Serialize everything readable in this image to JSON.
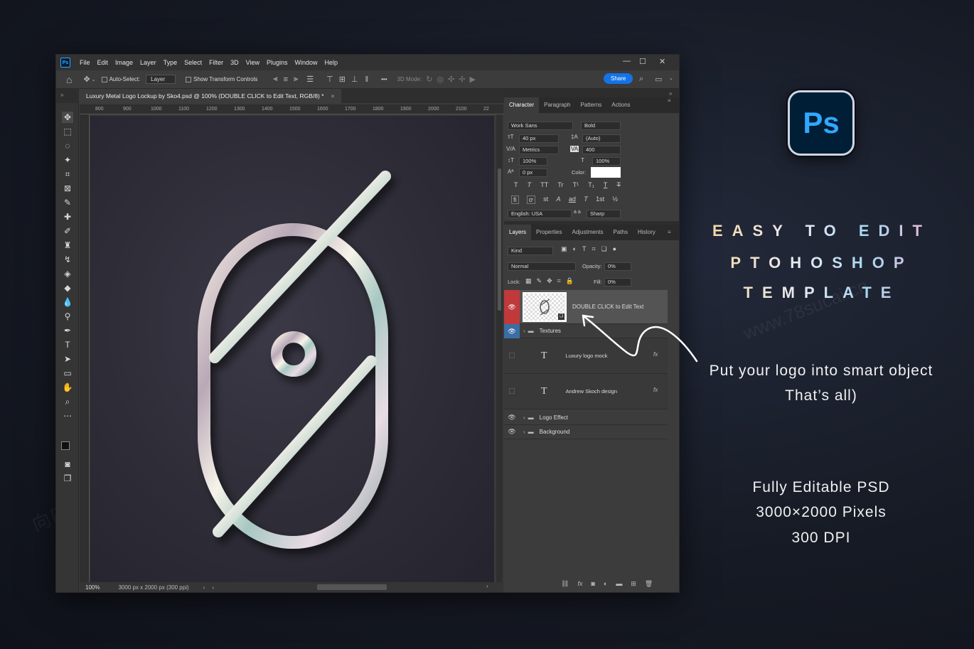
{
  "window": {
    "menu": [
      "File",
      "Edit",
      "Image",
      "Layer",
      "Type",
      "Select",
      "Filter",
      "3D",
      "View",
      "Plugins",
      "Window",
      "Help"
    ],
    "controls": [
      "—",
      "☐",
      "✕"
    ]
  },
  "options_bar": {
    "auto_select_label": "Auto-Select:",
    "auto_select_value": "Layer",
    "show_transform_label": "Show Transform Controls",
    "mode_3d_label": "3D Mode:",
    "more_label": "•••",
    "share_label": "Share"
  },
  "document": {
    "tab_title": "Luxury Metal Logo Lockup by Sko4.psd @ 100% (DOUBLE CLICK to Edit Text, RGB/8) *",
    "tab_close": "×",
    "ruler_top": [
      "800",
      "900",
      "1000",
      "1100",
      "1200",
      "1300",
      "1400",
      "1500",
      "1600",
      "1700",
      "1800",
      "1900",
      "2000",
      "2100",
      "22"
    ],
    "zoom": "100%",
    "size_info": "3000 px x 2000 px (300 ppi)"
  },
  "character_panel": {
    "tabs": [
      "Character",
      "Paragraph",
      "Patterns",
      "Actions"
    ],
    "font_family": "Work Sans",
    "font_style": "Bold",
    "size": "40 px",
    "leading": "(Auto)",
    "kerning": "Metrics",
    "tracking": "400",
    "vscale": "100%",
    "hscale": "100%",
    "baseline": "0 px",
    "color_label": "Color:",
    "language": "English: USA",
    "aa_label": "a a",
    "antialias": "Sharp",
    "type_buttons": [
      "T",
      "T",
      "TT",
      "Tr",
      "T¹",
      "T₁",
      "T",
      "T"
    ],
    "opentype_buttons": [
      "fi",
      "ơ",
      "st",
      "A",
      "ad",
      "T",
      "1st",
      "½"
    ]
  },
  "layers_panel": {
    "tabs": [
      "Layers",
      "Properties",
      "Adjustments",
      "Paths",
      "History"
    ],
    "filter_kind": "Kind",
    "blend_mode": "Normal",
    "opacity_label": "Opacity:",
    "opacity": "0%",
    "lock_label": "Lock:",
    "fill_label": "Fill:",
    "fill": "0%",
    "layers": [
      {
        "name": "DOUBLE CLICK to Edit Text",
        "kind": "smart"
      },
      {
        "name": "Textures",
        "kind": "group"
      },
      {
        "name": "Luxury logo mockup",
        "display": "Luxury logo mock",
        "kind": "text",
        "fx": "fx"
      },
      {
        "name": "Andrew Skoch design",
        "kind": "text",
        "fx": "fx"
      },
      {
        "name": "Logo Effect",
        "kind": "group"
      },
      {
        "name": "Background",
        "kind": "group"
      }
    ],
    "footer_icons": [
      "link-icon",
      "fx-icon",
      "mask-icon",
      "adjustment-icon",
      "folder-icon",
      "new-layer-icon",
      "trash-icon"
    ]
  },
  "marketing": {
    "badge": "Ps",
    "headline": [
      "EASY TO EDIT",
      "PTOHOSHOP",
      "TEMPLATE"
    ],
    "callout": [
      "Put your logo into smart object",
      "That’s all)"
    ],
    "specs": [
      "Fully Editable PSD",
      "3000×2000 Pixels",
      "300 DPI"
    ]
  },
  "colors": {
    "ps_blue": "#31a8ff",
    "ps_dark": "#001e36",
    "share_blue": "#1473e6",
    "selected_layer_red": "#c0393b"
  }
}
